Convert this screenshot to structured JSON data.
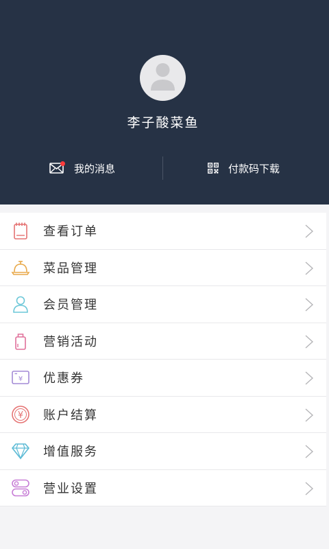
{
  "profile": {
    "name": "李子酸菜鱼"
  },
  "quick_actions": {
    "messages_label": "我的消息",
    "payment_code_label": "付款码下载",
    "has_unread": true
  },
  "menu": {
    "items": [
      {
        "label": "查看订单",
        "icon": "order-icon",
        "color": "#e57373"
      },
      {
        "label": "菜品管理",
        "icon": "dish-cloche-icon",
        "color": "#e8a94a"
      },
      {
        "label": "会员管理",
        "icon": "member-icon",
        "color": "#6cc7d8"
      },
      {
        "label": "营销活动",
        "icon": "shopping-bag-icon",
        "color": "#e0709a"
      },
      {
        "label": "优惠券",
        "icon": "coupon-icon",
        "color": "#a38ad6"
      },
      {
        "label": "账户结算",
        "icon": "yuan-coin-icon",
        "color": "#e57373"
      },
      {
        "label": "增值服务",
        "icon": "diamond-icon",
        "color": "#5bbad5"
      },
      {
        "label": "营业设置",
        "icon": "toggle-settings-icon",
        "color": "#c77dd6"
      }
    ]
  },
  "colors": {
    "header_bg": "#263245",
    "page_bg": "#f4f4f6",
    "unread_dot": "#ff3b3b"
  }
}
